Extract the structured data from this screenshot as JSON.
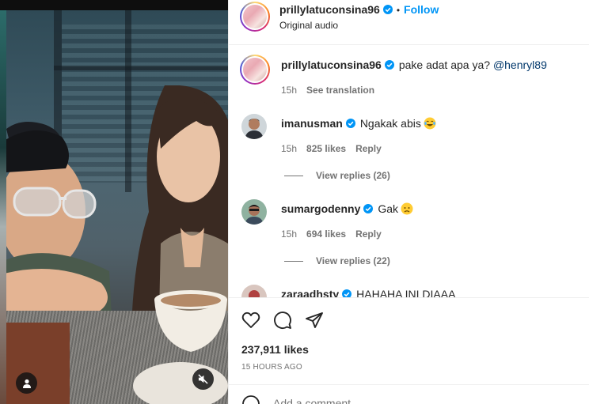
{
  "post": {
    "author": "prillylatuconsina96",
    "follow_label": "Follow",
    "separator": "•",
    "audio": "Original audio"
  },
  "comments": [
    {
      "username": "prillylatuconsina96",
      "verified": true,
      "text": "pake adat apa ya?",
      "mention": "@henryl89",
      "time": "15h",
      "see_translation": "See translation"
    },
    {
      "username": "imanusman",
      "verified": true,
      "text": "Ngakak abis",
      "emoji": "tears-of-joy-emoji",
      "time": "15h",
      "likes": "825 likes",
      "reply_label": "Reply",
      "view_replies": "View replies (26)"
    },
    {
      "username": "sumargodenny",
      "verified": true,
      "text": "Gak",
      "emoji": "disappointed-face-emoji",
      "time": "15h",
      "likes": "694 likes",
      "reply_label": "Reply",
      "view_replies": "View replies (22)"
    },
    {
      "username": "zaraadhsty",
      "verified": true,
      "text": "HAHAHA INI DIAAA"
    }
  ],
  "actions": {
    "like_icon": "heart-icon",
    "comment_icon": "comment-icon",
    "share_icon": "share-icon"
  },
  "likes_count": "237,911 likes",
  "posted_ago": "15 HOURS AGO",
  "add_comment_placeholder": "Add a comment...",
  "colors": {
    "accent": "#0095f6",
    "verified": "#0095f6",
    "text": "#262626",
    "muted": "#737373",
    "mention": "#00376b"
  }
}
